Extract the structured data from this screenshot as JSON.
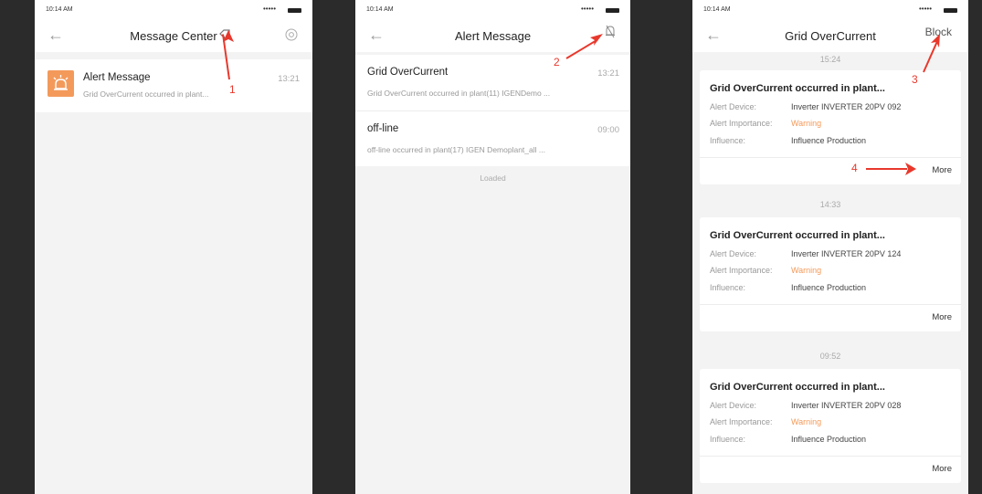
{
  "status": {
    "time": "10:14 AM",
    "signal": "•••••"
  },
  "screens": [
    {
      "title": "Message Center",
      "items": [
        {
          "title": "Alert Message",
          "desc": "Grid OverCurrent occurred in plant...",
          "time": "13:21"
        }
      ]
    },
    {
      "title": "Alert Message",
      "items": [
        {
          "title": "Grid OverCurrent",
          "desc": "Grid OverCurrent occurred in plant(11) IGENDemo ...",
          "time": "13:21"
        },
        {
          "title": "off-line",
          "desc": "off-line occurred in plant(17) IGEN Demoplant_all ...",
          "time": "09:00"
        }
      ],
      "footer": "Loaded"
    },
    {
      "title": "Grid OverCurrent",
      "action": "Block",
      "groups": [
        {
          "time": "15:24",
          "title": "Grid OverCurrent occurred in plant...",
          "device": "Inverter INVERTER 20PV 092",
          "importance": "Warning",
          "influence": "Influence Production"
        },
        {
          "time": "14:33",
          "title": "Grid OverCurrent occurred in plant...",
          "device": "Inverter INVERTER 20PV 124",
          "importance": "Warning",
          "influence": "Influence Production"
        },
        {
          "time": "09:52",
          "title": "Grid OverCurrent occurred in plant...",
          "device": "Inverter INVERTER 20PV 028",
          "importance": "Warning",
          "influence": "Influence Production"
        }
      ],
      "labels": {
        "device": "Alert Device:",
        "importance": "Alert Importance:",
        "influence": "Influence:",
        "more": "More"
      }
    }
  ],
  "annotations": [
    "1",
    "2",
    "3",
    "4"
  ],
  "colors": {
    "accent": "#f39a5b",
    "annotation": "#e8382c",
    "dark_gap": "#2b2b2b"
  }
}
